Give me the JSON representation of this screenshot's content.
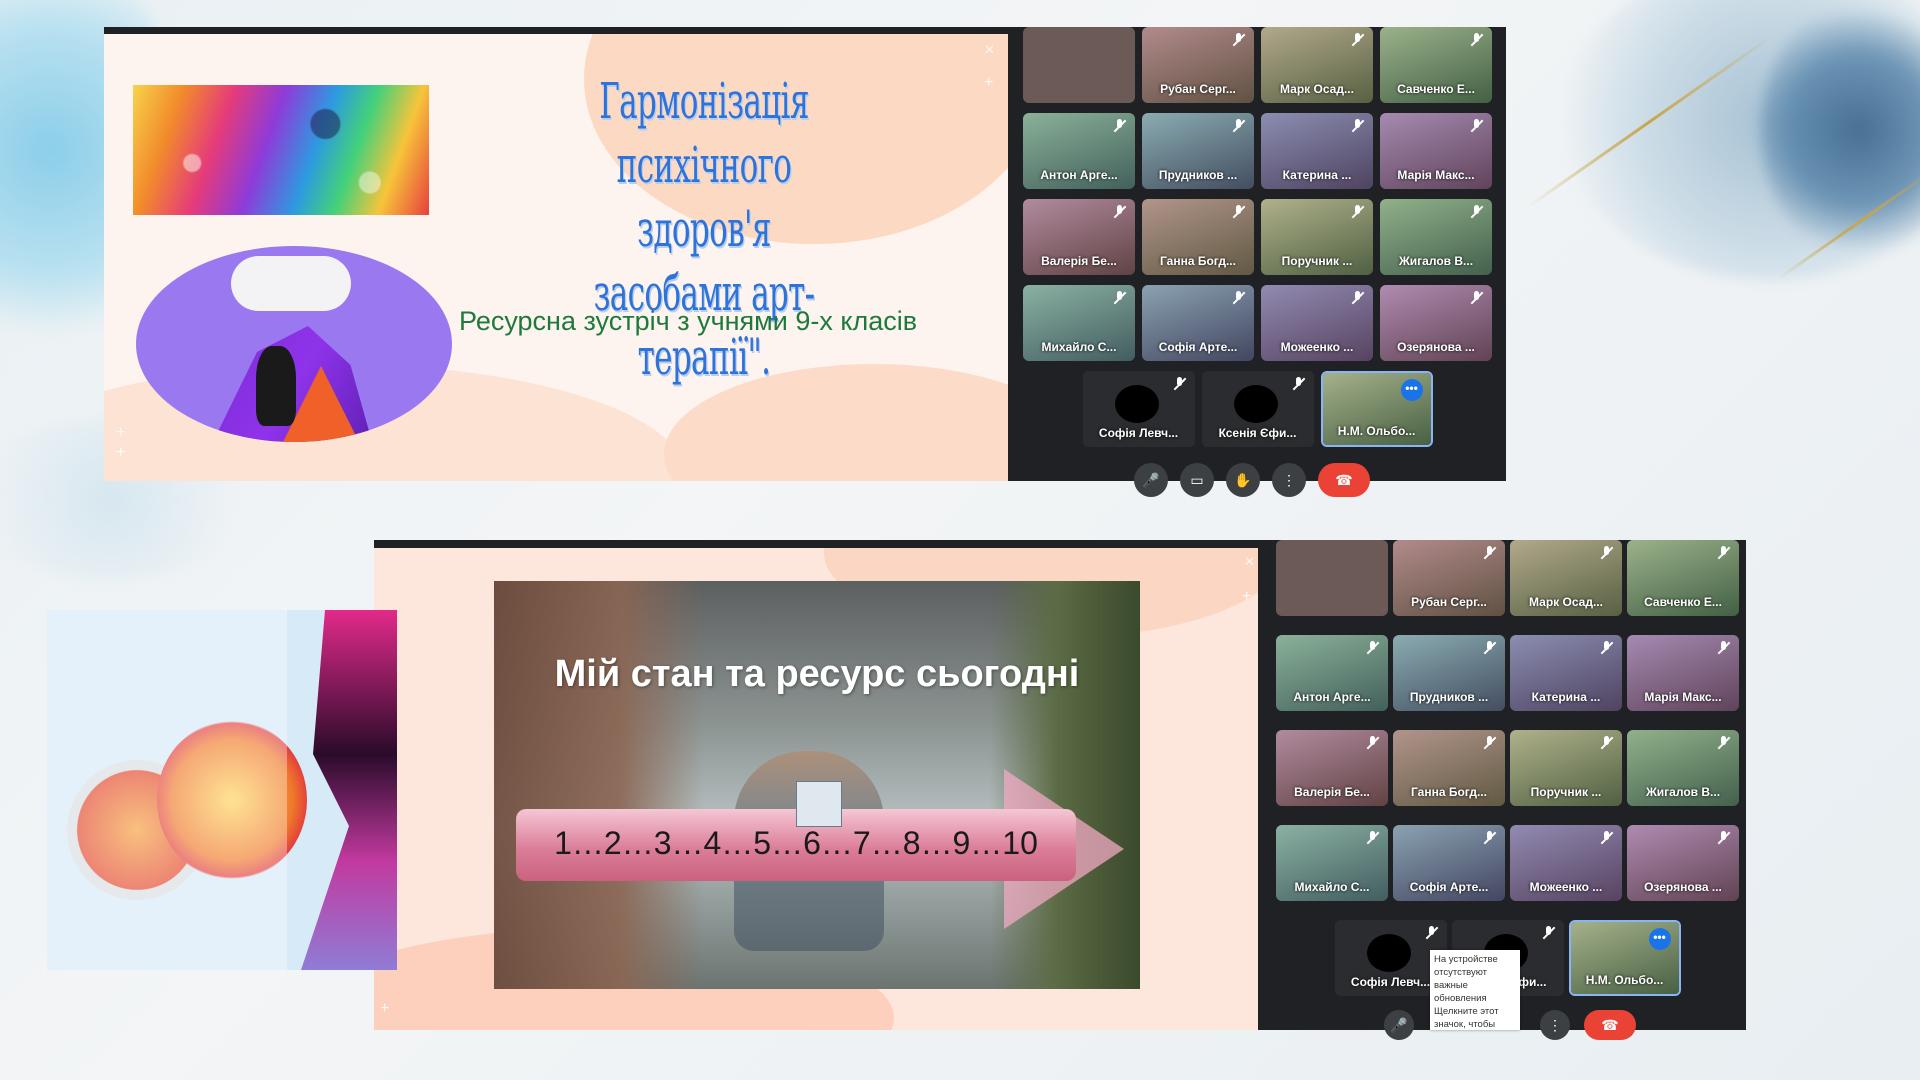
{
  "top_slide": {
    "title_line1": "Гармонізація психічного здоров'я",
    "title_line2": "засобами арт-терапії\".",
    "subtitle": "Ресурсна зустріч з учнями 9-х класів"
  },
  "bottom_slide": {
    "title": "Мій стан та ресурс сьогодні",
    "scale": "1…2…3…4…5…6…7…8…9…10"
  },
  "participants": [
    "Рубан Серг...",
    "Марк Осад...",
    "Савченко Е...",
    "Антон Арге...",
    "Прудников ...",
    "Катерина ...",
    "Марія Макс...",
    "Валерія Бе...",
    "Ганна Богд...",
    "Поручник ...",
    "Жигалов В...",
    "Михайло С...",
    "Софія Арте...",
    "Можеенко ...",
    "Озерянова ...",
    "Софія Левч...",
    "Ксенія Єфи...",
    "Н.М. Ольбо..."
  ],
  "tooltip": "На устройстве отсутствуют важные обновления Щелкните этот значок, чтобы",
  "colors": {
    "meet_bg": "#202124",
    "tile_bg": "#3c4043",
    "end_call": "#ea4335",
    "accent": "#1a73e8"
  },
  "icons": [
    "mic-icon",
    "camera-icon",
    "hand-icon",
    "more-icon",
    "end-call-icon"
  ]
}
